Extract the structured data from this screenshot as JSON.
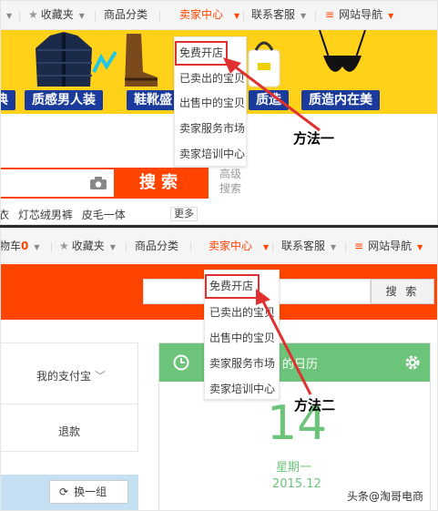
{
  "panel1": {
    "nav": {
      "favorites": "收藏夹",
      "categories": "商品分类",
      "seller_center": "卖家中心",
      "contact": "联系客服",
      "site_nav": "网站导航"
    },
    "banner_labels": [
      "典",
      "质感男人装",
      "鞋靴盛",
      "质造",
      "质造内在美"
    ],
    "search_button": "搜索",
    "hotwords": [
      "衣",
      "灯芯绒男裤",
      "皮毛一体"
    ],
    "more": "更多",
    "advanced_line1": "高级",
    "advanced_line2": "搜索",
    "dropdown": [
      "免费开店",
      "已卖出的宝贝",
      "出售中的宝贝",
      "卖家服务市场",
      "卖家培训中心"
    ],
    "method_label": "方法一"
  },
  "panel2": {
    "nav": {
      "cart": "物车",
      "cart_count": "0",
      "favorites": "收藏夹",
      "categories": "商品分类",
      "seller_center": "卖家中心",
      "contact": "联系客服",
      "site_nav": "网站导航"
    },
    "search_button": "搜 索",
    "alipay": "我的支付宝",
    "refund": "退款",
    "refresh": "换一组",
    "calendar_title": "的日历",
    "calendar_day": "14",
    "calendar_weekday": "星期一",
    "calendar_month": "2015.12",
    "dropdown": [
      "免费开店",
      "已卖出的宝贝",
      "出售中的宝贝",
      "卖家服务市场",
      "卖家培训中心"
    ],
    "method_label": "方法二"
  },
  "watermark": "头条@淘哥电商",
  "colors": {
    "accent": "#ff4400",
    "banner": "#ffd119",
    "calendar": "#6cc47a",
    "highlight_box": "#e03030"
  }
}
